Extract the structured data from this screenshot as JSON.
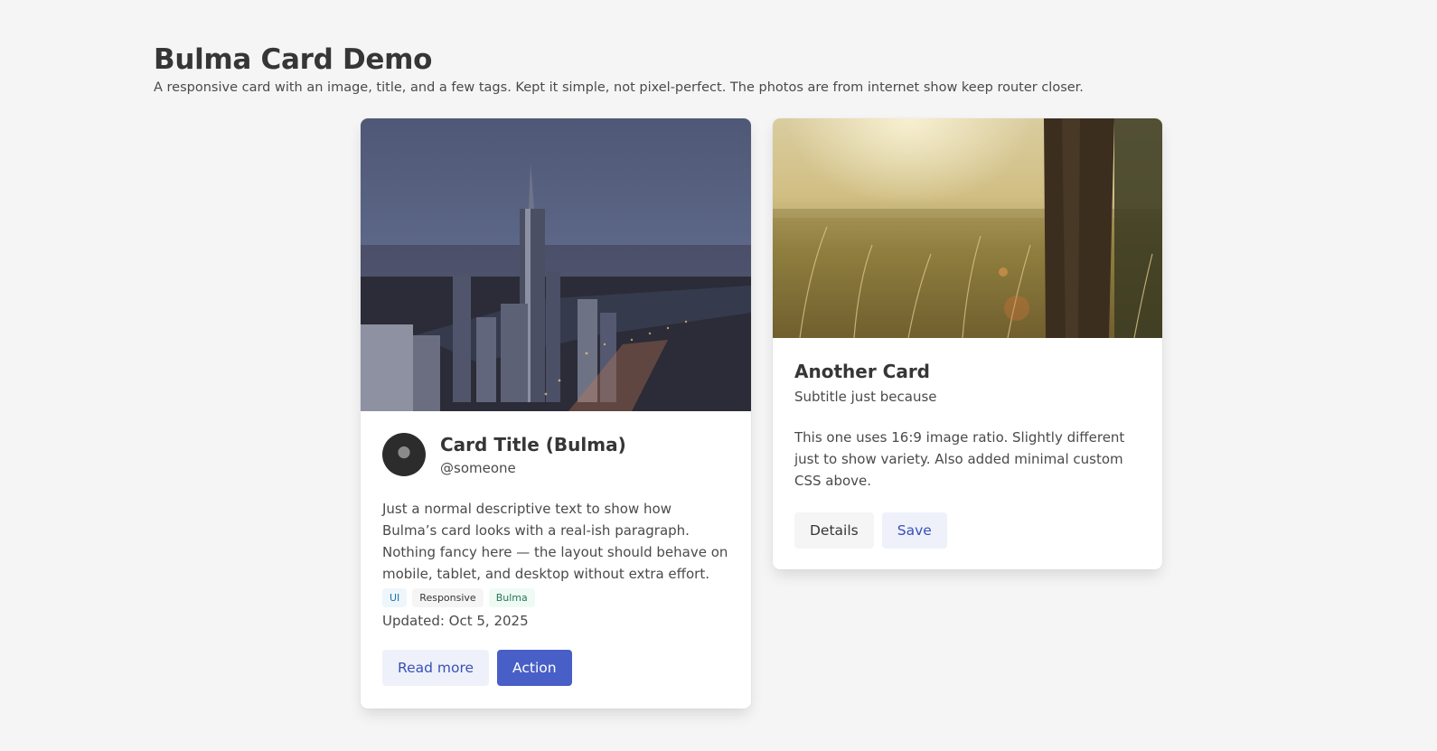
{
  "header": {
    "title": "Bulma Card Demo",
    "subtitle": "A responsive card with an image, title, and a few tags. Kept it simple, not pixel-perfect. The photos are from internet show keep router closer."
  },
  "card1": {
    "title": "Card Title (Bulma)",
    "handle": "@someone",
    "description": "Just a normal descriptive text to show how Bulma’s card looks with a real-ish paragraph. Nothing fancy here — the layout should behave on mobile, tablet, and desktop without extra effort.",
    "tags": [
      "UI",
      "Responsive",
      "Bulma"
    ],
    "updated": "Updated: Oct 5, 2025",
    "buttons": {
      "read_more": "Read more",
      "action": "Action"
    }
  },
  "card2": {
    "title": "Another Card",
    "subtitle": "Subtitle just because",
    "description": "This one uses 16:9 image ratio. Slightly different just to show variety. Also added minimal custom CSS above.",
    "buttons": {
      "details": "Details",
      "save": "Save"
    }
  },
  "colors": {
    "background": "#f5f5f5",
    "primary": "#485fc7",
    "primary_light": "#eff1fa"
  }
}
